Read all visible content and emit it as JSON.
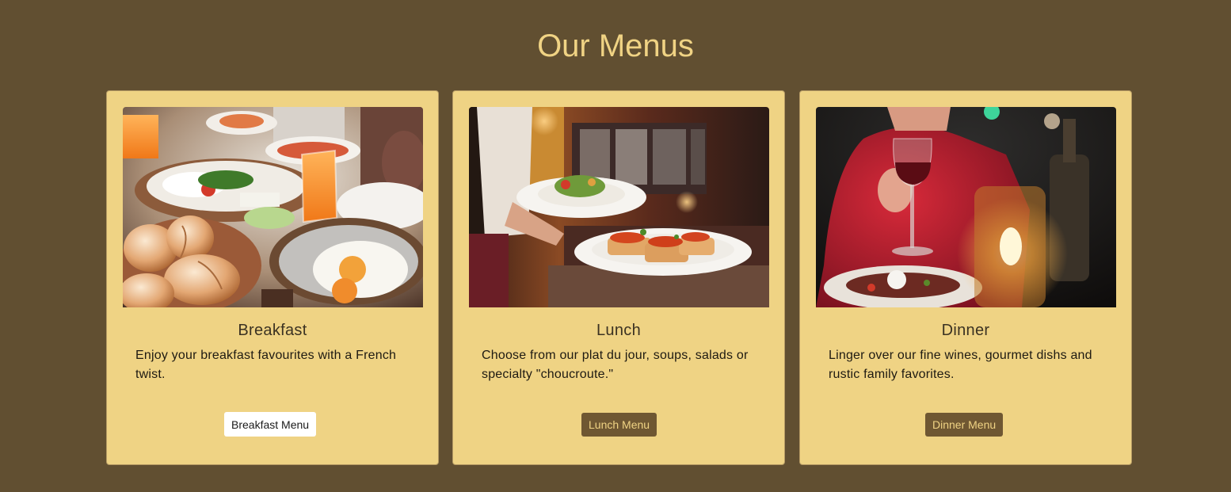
{
  "page": {
    "title": "Our Menus",
    "background": "#614f31",
    "title_color": "#f0d384",
    "card_color": "#efd384"
  },
  "cards": [
    {
      "title": "Breakfast",
      "text": "Enjoy your breakfast favourites with a French twist.",
      "button": "Breakfast Menu",
      "button_style": "light",
      "image": "breakfast-table-photo"
    },
    {
      "title": "Lunch",
      "text": "Choose from our plat du jour, soups, salads or specialty \"choucroute.\"",
      "button": "Lunch Menu",
      "button_style": "dark",
      "image": "waiter-serving-plates-photo"
    },
    {
      "title": "Dinner",
      "text": "Linger over our fine wines, gourmet dishs and rustic family favorites.",
      "button": "Dinner Menu",
      "button_style": "dark",
      "image": "candlelit-dinner-wine-photo"
    }
  ]
}
